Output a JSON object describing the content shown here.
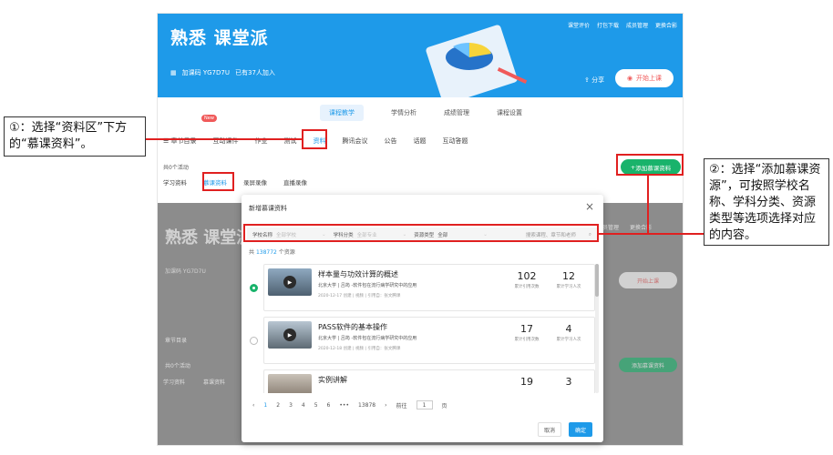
{
  "app": {
    "course_title": "熟悉 课堂派",
    "course_code": "加课码 YG7D7U",
    "joined": "已有37人加入",
    "top_actions": [
      "课堂评价",
      "打包下载",
      "成员管理",
      "更换合影"
    ],
    "share": "分享",
    "start_class": "开始上课"
  },
  "sub_nav": [
    "课程教学",
    "学情分析",
    "成绩管理",
    "课程设置"
  ],
  "main_nav": [
    "章节目录",
    "互动课件",
    "作业",
    "测试",
    "资料",
    "腾讯会议",
    "公告",
    "话题",
    "互动答题"
  ],
  "new_badge": "New",
  "activity_count": "共0个活动",
  "resource_tabs": [
    "学习资料",
    "慕课资料",
    "录屏录像",
    "直播录像"
  ],
  "add_mooc_button": "添加慕课资料",
  "modal": {
    "title": "新增慕课资料",
    "filters": [
      {
        "label": "学校名称",
        "placeholder": "全部学校"
      },
      {
        "label": "学科分类",
        "placeholder": "全部专业"
      },
      {
        "label": "资源类型",
        "placeholder": "全部"
      }
    ],
    "search_placeholder": "搜索课程、章节和老师",
    "total_prefix": "共",
    "total_count": "138772",
    "total_suffix": "个资源",
    "items": [
      {
        "title": "样本量与功效计算的概述",
        "school": "北京大学",
        "desc": "吕筠 -软件包在流行病学研究中的应用",
        "date": "2020-12-17 创建",
        "type": "视频",
        "cite": "引用自：张文腾课",
        "cite_count": "102",
        "cite_label": "累计引用次数",
        "learn_count": "12",
        "learn_label": "累计学习人次",
        "selected": true
      },
      {
        "title": "PASS软件的基本操作",
        "school": "北京大学",
        "desc": "吕筠 -软件包在流行病学研究中的应用",
        "date": "2020-12-18 创建",
        "type": "视频",
        "cite": "引用自：张文腾课",
        "cite_count": "17",
        "cite_label": "累计引用次数",
        "learn_count": "4",
        "learn_label": "累计学习人次",
        "selected": false
      },
      {
        "title": "实例讲解",
        "school": "",
        "desc": "",
        "date": "",
        "type": "",
        "cite": "",
        "cite_count": "19",
        "cite_label": "",
        "learn_count": "3",
        "learn_label": "",
        "selected": false
      }
    ],
    "pager": {
      "prev": "‹",
      "pages": [
        "1",
        "2",
        "3",
        "4",
        "5",
        "6"
      ],
      "ellipsis": "•••",
      "last": "13878",
      "next": "›",
      "goto": "前往",
      "goto_value": "1",
      "page_unit": "页"
    },
    "cancel": "取消",
    "confirm": "确定"
  },
  "callout_left": "①：选择“资料区”下方的“慕课资料”。",
  "callout_right": "②：选择“添加慕课资源”，可按照学校名称、学科分类、资源类型等选项选择对应的内容。",
  "colors": {
    "accent": "#1e9ae9",
    "green": "#19b36b",
    "red": "#e02020"
  }
}
